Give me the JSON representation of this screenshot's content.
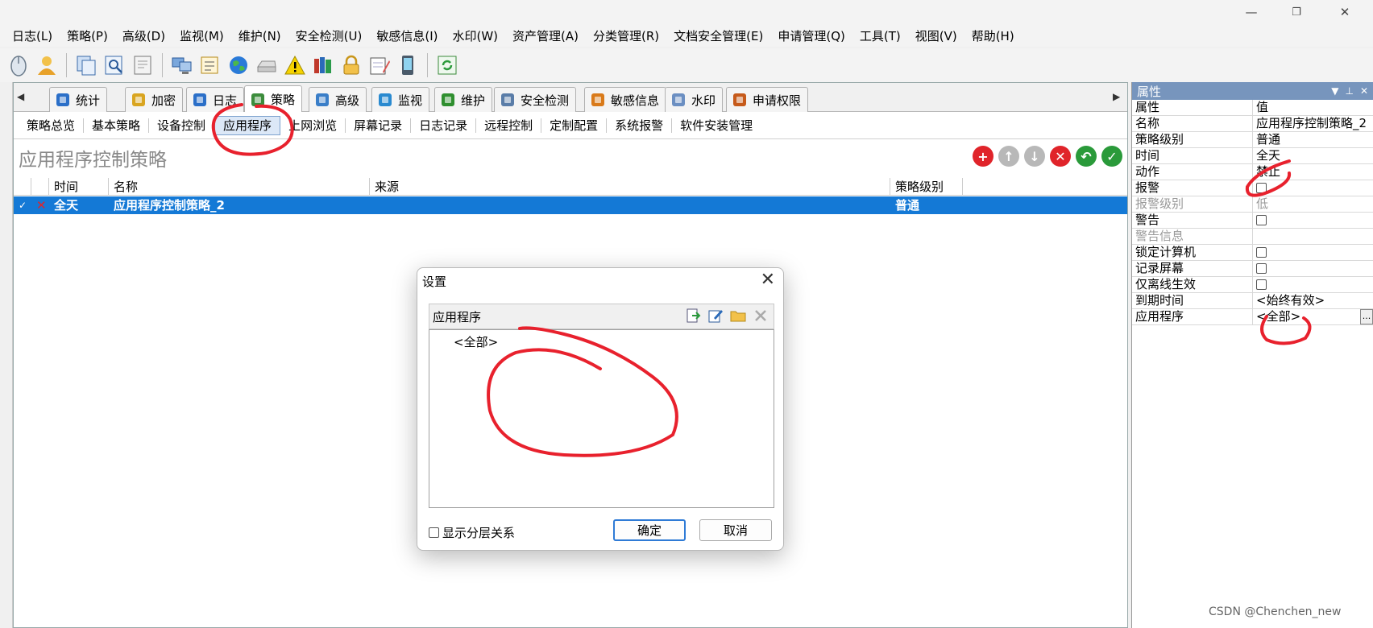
{
  "window": {
    "minimize": "—",
    "maximize": "❐",
    "close": "✕"
  },
  "menu": [
    "日志(L)",
    "策略(P)",
    "高级(D)",
    "监视(M)",
    "维护(N)",
    "安全检测(U)",
    "敏感信息(I)",
    "水印(W)",
    "资产管理(A)",
    "分类管理(R)",
    "文档安全管理(E)",
    "申请管理(Q)",
    "工具(T)",
    "视图(V)",
    "帮助(H)"
  ],
  "toolbar_icons": [
    "mouse-icon",
    "user-icon",
    "copy-icon",
    "preview-icon",
    "report-icon",
    "computers-icon",
    "edit-list-icon",
    "globe-icon",
    "drive-icon",
    "warning-icon",
    "books-icon",
    "lock-icon",
    "notepad-icon",
    "phone-icon",
    "refresh-icon"
  ],
  "tabs": [
    {
      "label": "统计",
      "icon": "chart-icon",
      "color": "#2b6fc8"
    },
    {
      "label": "加密",
      "icon": "lock-icon",
      "color": "#d9a520"
    },
    {
      "label": "日志",
      "icon": "log-icon",
      "color": "#2b6fc8"
    },
    {
      "label": "策略",
      "icon": "policy-icon",
      "color": "#3c8c3c"
    },
    {
      "label": "高级",
      "icon": "advanced-icon",
      "color": "#3a7ec8"
    },
    {
      "label": "监视",
      "icon": "monitor-icon",
      "color": "#2a8ad0"
    },
    {
      "label": "维护",
      "icon": "maintain-icon",
      "color": "#2f8f2f"
    },
    {
      "label": "安全检测",
      "icon": "scan-icon",
      "color": "#5a7da8"
    },
    {
      "label": "敏感信息",
      "icon": "sensitive-icon",
      "color": "#d97a1a"
    },
    {
      "label": "水印",
      "icon": "watermark-icon",
      "color": "#6b8fc2"
    },
    {
      "label": "申请权限",
      "icon": "apply-icon",
      "color": "#c65a1a"
    }
  ],
  "subtabs": [
    "策略总览",
    "基本策略",
    "设备控制",
    "应用程序",
    "上网浏览",
    "屏幕记录",
    "日志记录",
    "远程控制",
    "定制配置",
    "系统报警",
    "软件安装管理"
  ],
  "subtab_selected": "应用程序",
  "page_title": "应用程序控制策略",
  "action_colors": {
    "add": "#e0242a",
    "up": "#b8b8b8",
    "down": "#b8b8b8",
    "delete": "#e0242a",
    "undo": "#2a9a3a",
    "confirm": "#2a9a3a"
  },
  "table": {
    "headers": [
      "时间",
      "名称",
      "来源",
      "策略级别"
    ],
    "rows": [
      {
        "check": "✓",
        "mark": "✕",
        "time": "全天",
        "name": "应用程序控制策略_2",
        "source": "",
        "level": "普通"
      }
    ]
  },
  "properties": {
    "title": "属性",
    "header_key": "属性",
    "header_value": "值",
    "rows": [
      {
        "k": "名称",
        "v": "应用程序控制策略_2"
      },
      {
        "k": "策略级别",
        "v": "普通"
      },
      {
        "k": "时间",
        "v": "全天"
      },
      {
        "k": "动作",
        "v": "禁止"
      },
      {
        "k": "报警",
        "v": "",
        "checkbox": true
      },
      {
        "k": "报警级别",
        "v": "低",
        "disabled": true
      },
      {
        "k": "警告",
        "v": "",
        "checkbox": true
      },
      {
        "k": "警告信息",
        "v": "",
        "disabled": true
      },
      {
        "k": "锁定计算机",
        "v": "",
        "checkbox": true
      },
      {
        "k": "记录屏幕",
        "v": "",
        "checkbox": true
      },
      {
        "k": "仅离线生效",
        "v": "",
        "checkbox": true
      },
      {
        "k": "到期时间",
        "v": "<始终有效>"
      },
      {
        "k": "应用程序",
        "v": "<全部>",
        "ellipsis": "..."
      }
    ]
  },
  "dialog": {
    "title": "设置",
    "close": "✕",
    "section_label": "应用程序",
    "list_items": [
      "<全部>"
    ],
    "show_hierarchy": "显示分层关系",
    "ok": "确定",
    "cancel": "取消"
  },
  "watermark": "CSDN @Chenchen_new"
}
